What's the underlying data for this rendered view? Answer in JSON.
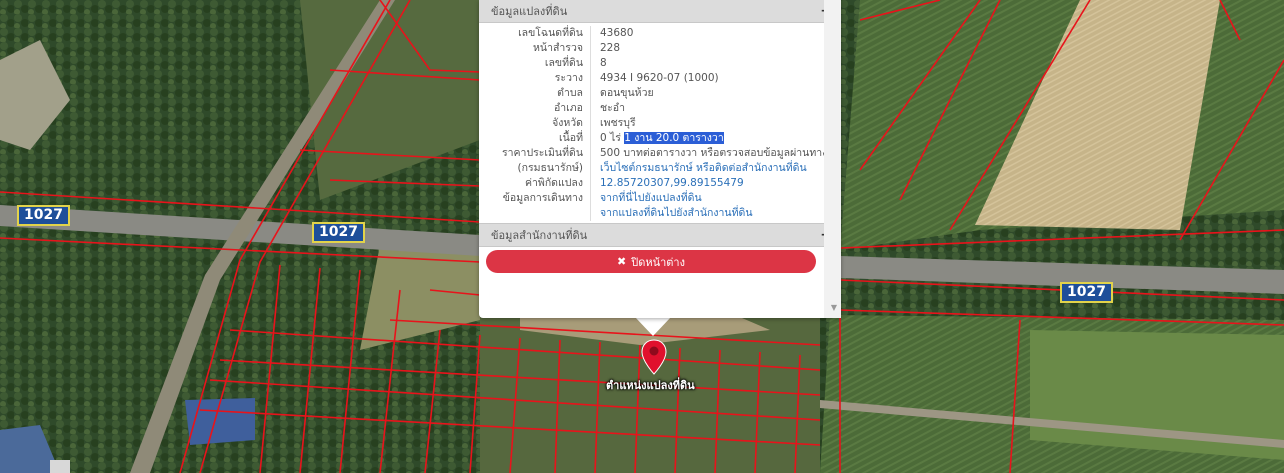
{
  "map": {
    "road_labels": [
      "1027",
      "1027",
      "1027"
    ],
    "parcel_line_color": "#e8131b",
    "marker": {
      "label": "ตำแหน่งแปลงที่ดิน",
      "color": "#e0102d"
    }
  },
  "popup": {
    "section1": {
      "title": "ข้อมูลแปลงที่ดิน",
      "toggle": "−"
    },
    "rows": [
      {
        "key": "เลขโฉนดที่ดิน",
        "value": "43680"
      },
      {
        "key": "หน้าสำรวจ",
        "value": "228"
      },
      {
        "key": "เลขที่ดิน",
        "value": "8"
      },
      {
        "key": "ระวาง",
        "value": "4934 I 9620-07 (1000)"
      },
      {
        "key": "ตำบล",
        "value": "ดอนขุนห้วย"
      },
      {
        "key": "อำเภอ",
        "value": "ชะอำ"
      },
      {
        "key": "จังหวัด",
        "value": "เพชรบุรี"
      },
      {
        "key": "เนื้อที่",
        "value_prefix": "0 ไร่ ",
        "value_highlight": "1 งาน 20.0 ตารางวา"
      },
      {
        "key": "ราคาประเมินที่ดิน",
        "value": "500 บาทต่อตารางวา หรือตรวจสอบข้อมูลผ่านทาง"
      },
      {
        "key": "(กรมธนารักษ์)",
        "value": "เว็บไซต์กรมธนารักษ์ หรือติดต่อสำนักงานที่ดิน",
        "link": true
      },
      {
        "key": "ค่าพิกัดแปลง",
        "value": "12.85720307,99.89155479",
        "link": true
      },
      {
        "key": "ข้อมูลการเดินทาง",
        "value": "จากที่นี่ไปยังแปลงที่ดิน",
        "link": true
      },
      {
        "key": "",
        "value": "จากแปลงที่ดินไปยังสำนักงานที่ดิน",
        "link": true
      }
    ],
    "section2": {
      "title": "ข้อมูลสำนักงานที่ดิน",
      "toggle": "+"
    },
    "close_button": {
      "icon": "✖",
      "label": "ปิดหน้าต่าง"
    }
  }
}
